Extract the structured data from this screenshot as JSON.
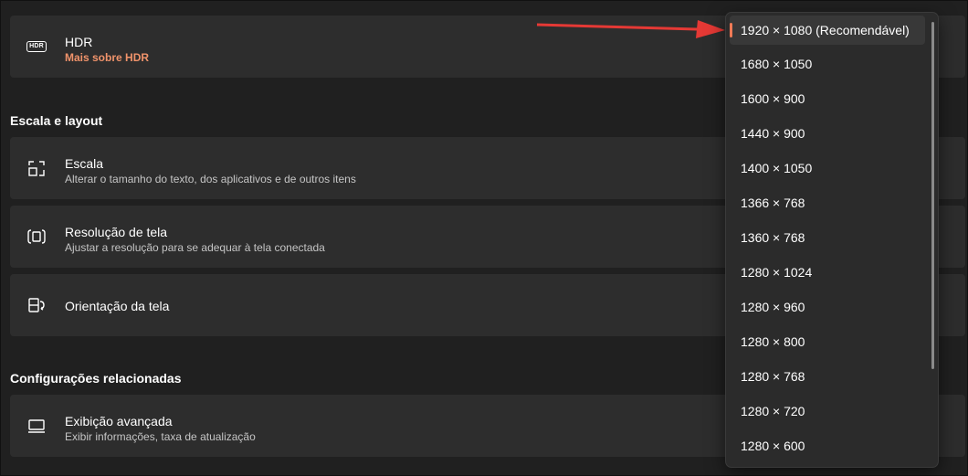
{
  "hdr_card": {
    "title": "HDR",
    "link": "Mais sobre HDR",
    "icon": "hdr-icon"
  },
  "section_scale": "Escala e layout",
  "scale_card": {
    "title": "Escala",
    "subtitle": "Alterar o tamanho do texto, dos aplicativos e de outros itens",
    "icon": "scale-icon"
  },
  "resolution_card": {
    "title": "Resolução de tela",
    "subtitle": "Ajustar a resolução para se adequar à tela conectada",
    "icon": "resolution-icon"
  },
  "orientation_card": {
    "title": "Orientação da tela",
    "icon": "orientation-icon"
  },
  "section_related": "Configurações relacionadas",
  "advanced_card": {
    "title": "Exibição avançada",
    "subtitle": "Exibir informações, taxa de atualização",
    "icon": "monitor-icon"
  },
  "dropdown": {
    "selected_index": 0,
    "options": [
      "1920 × 1080 (Recomendável)",
      "1680 × 1050",
      "1600 × 900",
      "1440 × 900",
      "1400 × 1050",
      "1366 × 768",
      "1360 × 768",
      "1280 × 1024",
      "1280 × 960",
      "1280 × 800",
      "1280 × 768",
      "1280 × 720",
      "1280 × 600"
    ]
  },
  "colors": {
    "accent": "#f07a56",
    "link": "#f0936b",
    "card": "#2d2d2d",
    "background": "#202020",
    "arrow": "#e53935"
  }
}
